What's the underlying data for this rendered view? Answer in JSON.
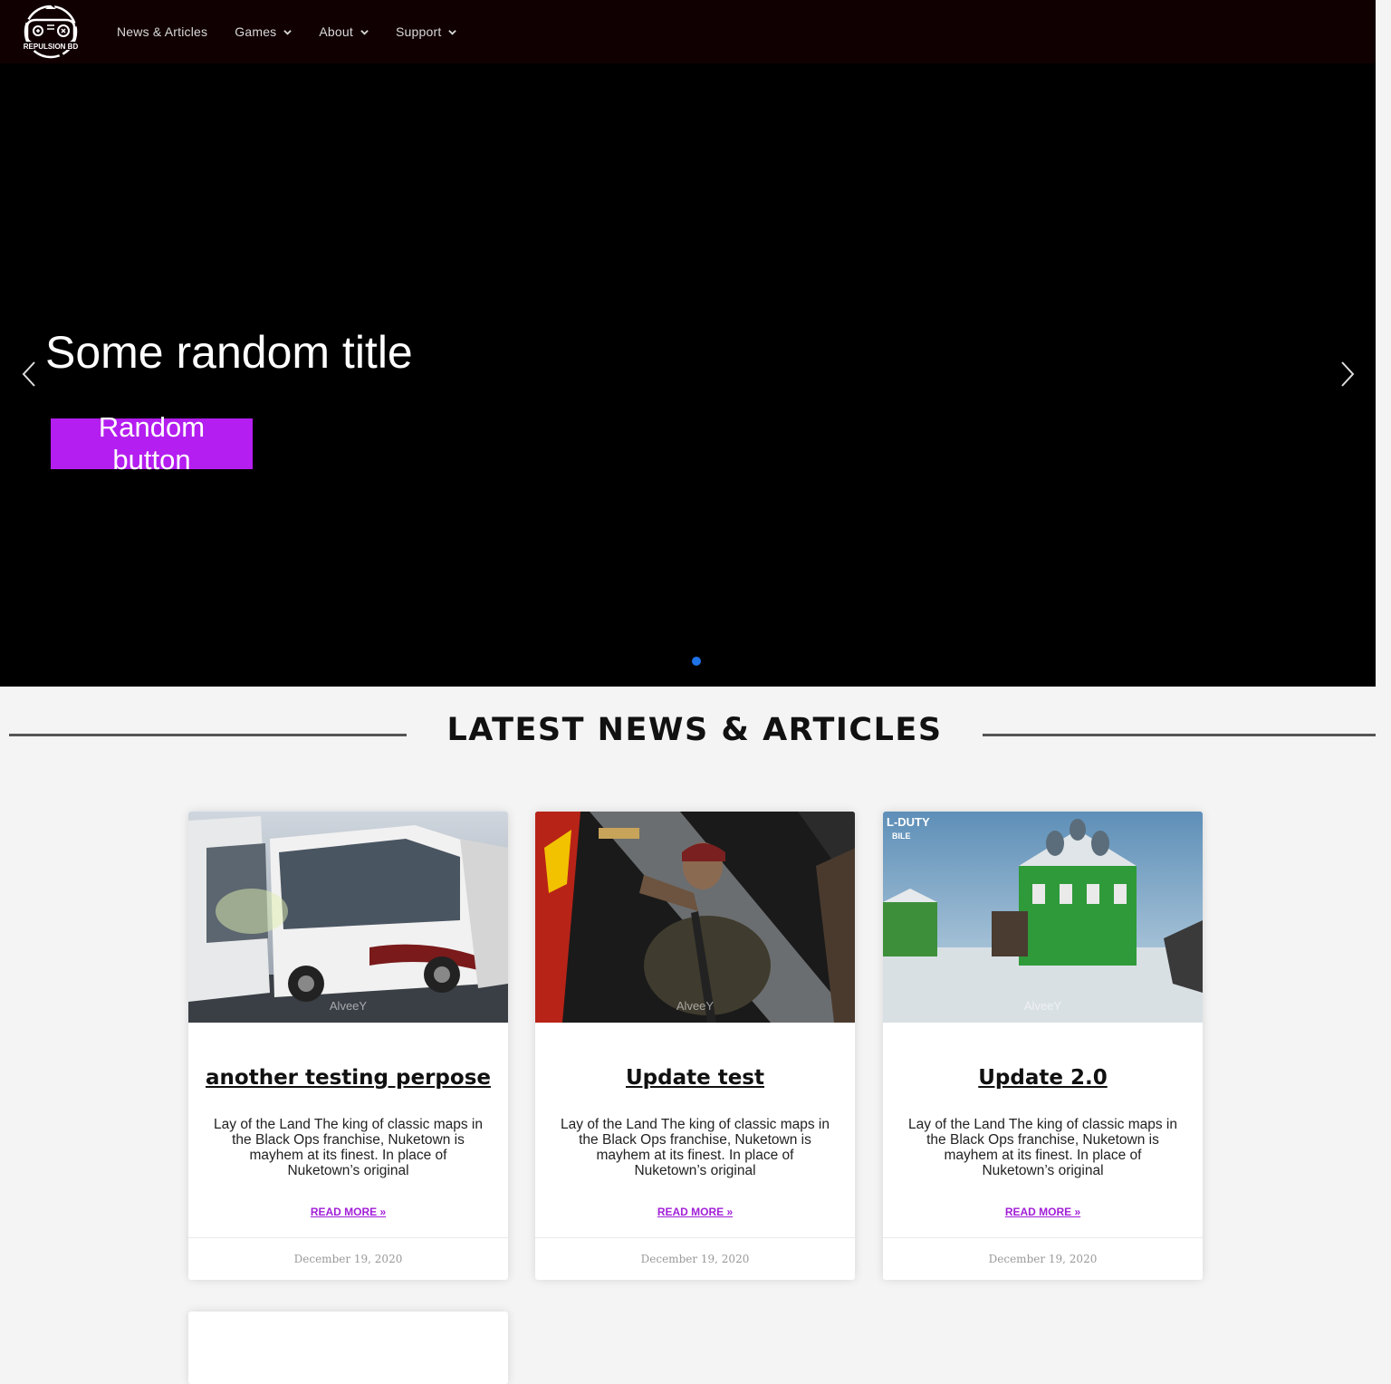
{
  "header": {
    "logo_text": "REPULSION BD",
    "nav": [
      {
        "label": "News & Articles",
        "has_dropdown": false
      },
      {
        "label": "Games",
        "has_dropdown": true
      },
      {
        "label": "About",
        "has_dropdown": true
      },
      {
        "label": "Support",
        "has_dropdown": true
      }
    ]
  },
  "hero": {
    "title": "Some random title",
    "button_label": "Random button",
    "button_color": "#b41ef0",
    "dot_color": "#1e73e6"
  },
  "section": {
    "title": "LATEST NEWS & ARTICLES"
  },
  "cards": [
    {
      "image": "bus-image",
      "watermark": "AlveeY",
      "title": "another testing perpose",
      "excerpt": "Lay of the Land The king of classic maps in the Black Ops franchise, Nuketown is mayhem at its finest. In place of Nuketown’s original",
      "read_more": "READ MORE »",
      "date": "December 19, 2020"
    },
    {
      "image": "soldier-image",
      "watermark": "AlveeY",
      "title": "Update test",
      "excerpt": "Lay of the Land The king of classic maps in the Black Ops franchise, Nuketown is mayhem at its finest. In place of Nuketown’s original",
      "read_more": "READ MORE »",
      "date": "December 19, 2020"
    },
    {
      "image": "green-house-image",
      "watermark": "AlveeY",
      "title": "Update 2.0",
      "excerpt": "Lay of the Land The king of classic maps in the Black Ops franchise, Nuketown is mayhem at its finest. In place of Nuketown’s original",
      "read_more": "READ MORE »",
      "date": "December 19, 2020",
      "image_text": "L-DUTY\nBILE"
    }
  ],
  "colors": {
    "header_bg": "#110002",
    "accent": "#b41ef0",
    "read_more": "#a21ed8",
    "page_bg": "#f4f4f4"
  }
}
